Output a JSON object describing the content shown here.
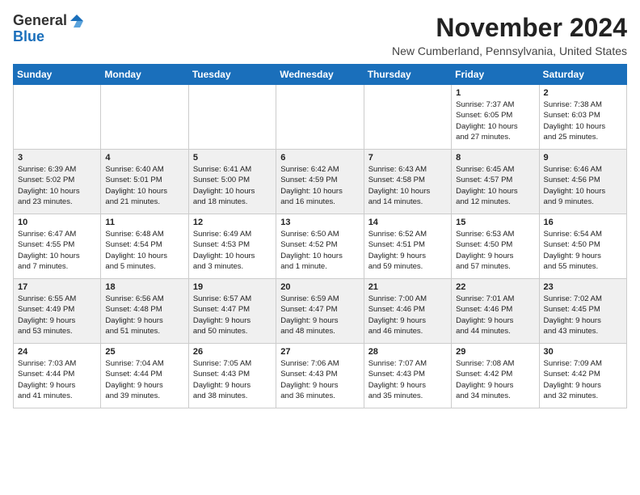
{
  "header": {
    "logo_general": "General",
    "logo_blue": "Blue",
    "month_title": "November 2024",
    "location": "New Cumberland, Pennsylvania, United States"
  },
  "days_of_week": [
    "Sunday",
    "Monday",
    "Tuesday",
    "Wednesday",
    "Thursday",
    "Friday",
    "Saturday"
  ],
  "weeks": [
    [
      {
        "day": "",
        "info": ""
      },
      {
        "day": "",
        "info": ""
      },
      {
        "day": "",
        "info": ""
      },
      {
        "day": "",
        "info": ""
      },
      {
        "day": "",
        "info": ""
      },
      {
        "day": "1",
        "info": "Sunrise: 7:37 AM\nSunset: 6:05 PM\nDaylight: 10 hours\nand 27 minutes."
      },
      {
        "day": "2",
        "info": "Sunrise: 7:38 AM\nSunset: 6:03 PM\nDaylight: 10 hours\nand 25 minutes."
      }
    ],
    [
      {
        "day": "3",
        "info": "Sunrise: 6:39 AM\nSunset: 5:02 PM\nDaylight: 10 hours\nand 23 minutes."
      },
      {
        "day": "4",
        "info": "Sunrise: 6:40 AM\nSunset: 5:01 PM\nDaylight: 10 hours\nand 21 minutes."
      },
      {
        "day": "5",
        "info": "Sunrise: 6:41 AM\nSunset: 5:00 PM\nDaylight: 10 hours\nand 18 minutes."
      },
      {
        "day": "6",
        "info": "Sunrise: 6:42 AM\nSunset: 4:59 PM\nDaylight: 10 hours\nand 16 minutes."
      },
      {
        "day": "7",
        "info": "Sunrise: 6:43 AM\nSunset: 4:58 PM\nDaylight: 10 hours\nand 14 minutes."
      },
      {
        "day": "8",
        "info": "Sunrise: 6:45 AM\nSunset: 4:57 PM\nDaylight: 10 hours\nand 12 minutes."
      },
      {
        "day": "9",
        "info": "Sunrise: 6:46 AM\nSunset: 4:56 PM\nDaylight: 10 hours\nand 9 minutes."
      }
    ],
    [
      {
        "day": "10",
        "info": "Sunrise: 6:47 AM\nSunset: 4:55 PM\nDaylight: 10 hours\nand 7 minutes."
      },
      {
        "day": "11",
        "info": "Sunrise: 6:48 AM\nSunset: 4:54 PM\nDaylight: 10 hours\nand 5 minutes."
      },
      {
        "day": "12",
        "info": "Sunrise: 6:49 AM\nSunset: 4:53 PM\nDaylight: 10 hours\nand 3 minutes."
      },
      {
        "day": "13",
        "info": "Sunrise: 6:50 AM\nSunset: 4:52 PM\nDaylight: 10 hours\nand 1 minute."
      },
      {
        "day": "14",
        "info": "Sunrise: 6:52 AM\nSunset: 4:51 PM\nDaylight: 9 hours\nand 59 minutes."
      },
      {
        "day": "15",
        "info": "Sunrise: 6:53 AM\nSunset: 4:50 PM\nDaylight: 9 hours\nand 57 minutes."
      },
      {
        "day": "16",
        "info": "Sunrise: 6:54 AM\nSunset: 4:50 PM\nDaylight: 9 hours\nand 55 minutes."
      }
    ],
    [
      {
        "day": "17",
        "info": "Sunrise: 6:55 AM\nSunset: 4:49 PM\nDaylight: 9 hours\nand 53 minutes."
      },
      {
        "day": "18",
        "info": "Sunrise: 6:56 AM\nSunset: 4:48 PM\nDaylight: 9 hours\nand 51 minutes."
      },
      {
        "day": "19",
        "info": "Sunrise: 6:57 AM\nSunset: 4:47 PM\nDaylight: 9 hours\nand 50 minutes."
      },
      {
        "day": "20",
        "info": "Sunrise: 6:59 AM\nSunset: 4:47 PM\nDaylight: 9 hours\nand 48 minutes."
      },
      {
        "day": "21",
        "info": "Sunrise: 7:00 AM\nSunset: 4:46 PM\nDaylight: 9 hours\nand 46 minutes."
      },
      {
        "day": "22",
        "info": "Sunrise: 7:01 AM\nSunset: 4:46 PM\nDaylight: 9 hours\nand 44 minutes."
      },
      {
        "day": "23",
        "info": "Sunrise: 7:02 AM\nSunset: 4:45 PM\nDaylight: 9 hours\nand 43 minutes."
      }
    ],
    [
      {
        "day": "24",
        "info": "Sunrise: 7:03 AM\nSunset: 4:44 PM\nDaylight: 9 hours\nand 41 minutes."
      },
      {
        "day": "25",
        "info": "Sunrise: 7:04 AM\nSunset: 4:44 PM\nDaylight: 9 hours\nand 39 minutes."
      },
      {
        "day": "26",
        "info": "Sunrise: 7:05 AM\nSunset: 4:43 PM\nDaylight: 9 hours\nand 38 minutes."
      },
      {
        "day": "27",
        "info": "Sunrise: 7:06 AM\nSunset: 4:43 PM\nDaylight: 9 hours\nand 36 minutes."
      },
      {
        "day": "28",
        "info": "Sunrise: 7:07 AM\nSunset: 4:43 PM\nDaylight: 9 hours\nand 35 minutes."
      },
      {
        "day": "29",
        "info": "Sunrise: 7:08 AM\nSunset: 4:42 PM\nDaylight: 9 hours\nand 34 minutes."
      },
      {
        "day": "30",
        "info": "Sunrise: 7:09 AM\nSunset: 4:42 PM\nDaylight: 9 hours\nand 32 minutes."
      }
    ]
  ]
}
